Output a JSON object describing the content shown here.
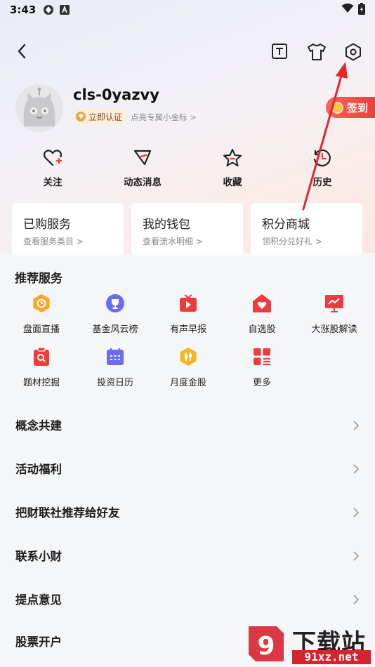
{
  "status_bar": {
    "time": "3:43"
  },
  "nav": {
    "icons": [
      "back-arrow-icon",
      "text-mode-icon",
      "tshirt-icon",
      "settings-hex-icon"
    ]
  },
  "profile": {
    "username": "cls-0yazvy",
    "cert_label": "立即认证",
    "cert_hint": "点亮专属小金标 >",
    "signin_label": "签到"
  },
  "quick_actions": [
    {
      "label": "关注",
      "icon": "heart-plus-icon"
    },
    {
      "label": "动态消息",
      "icon": "message-icon"
    },
    {
      "label": "收藏",
      "icon": "star-icon"
    },
    {
      "label": "历史",
      "icon": "history-clock-icon"
    }
  ],
  "cards": [
    {
      "title": "已购服务",
      "sub": "查看服务类目 >"
    },
    {
      "title": "我的钱包",
      "sub": "查看流水明细 >"
    },
    {
      "title": "积分商城",
      "sub": "领积分兑好礼 >"
    }
  ],
  "recommended": {
    "title": "推荐服务",
    "items": [
      {
        "label": "盘面直播",
        "icon": "live-hex-icon",
        "color": "#f5a623"
      },
      {
        "label": "基金风云榜",
        "icon": "trophy-icon",
        "color": "#6c6cf2"
      },
      {
        "label": "有声早报",
        "icon": "tv-play-icon",
        "color": "#ef3b3b"
      },
      {
        "label": "自选股",
        "icon": "heart-house-icon",
        "color": "#ef3b3b"
      },
      {
        "label": "大涨股解读",
        "icon": "chart-board-icon",
        "color": "#ef3b3b"
      },
      {
        "label": "题材挖掘",
        "icon": "search-clipboard-icon",
        "color": "#ef3b3b"
      },
      {
        "label": "投资日历",
        "icon": "calendar-icon",
        "color": "#6c6cf2"
      },
      {
        "label": "月度金股",
        "icon": "gold-stock-icon",
        "color": "#f5b623"
      },
      {
        "label": "更多",
        "icon": "more-grid-icon",
        "color": "#ef3b3b"
      }
    ]
  },
  "menu": [
    {
      "label": "概念共建"
    },
    {
      "label": "活动福利"
    },
    {
      "label": "把财联社推荐给好友"
    },
    {
      "label": "联系小财"
    },
    {
      "label": "提点意见"
    },
    {
      "label": "股票开户"
    }
  ],
  "watermark": {
    "text": "下载站",
    "url": "91xz.net"
  }
}
